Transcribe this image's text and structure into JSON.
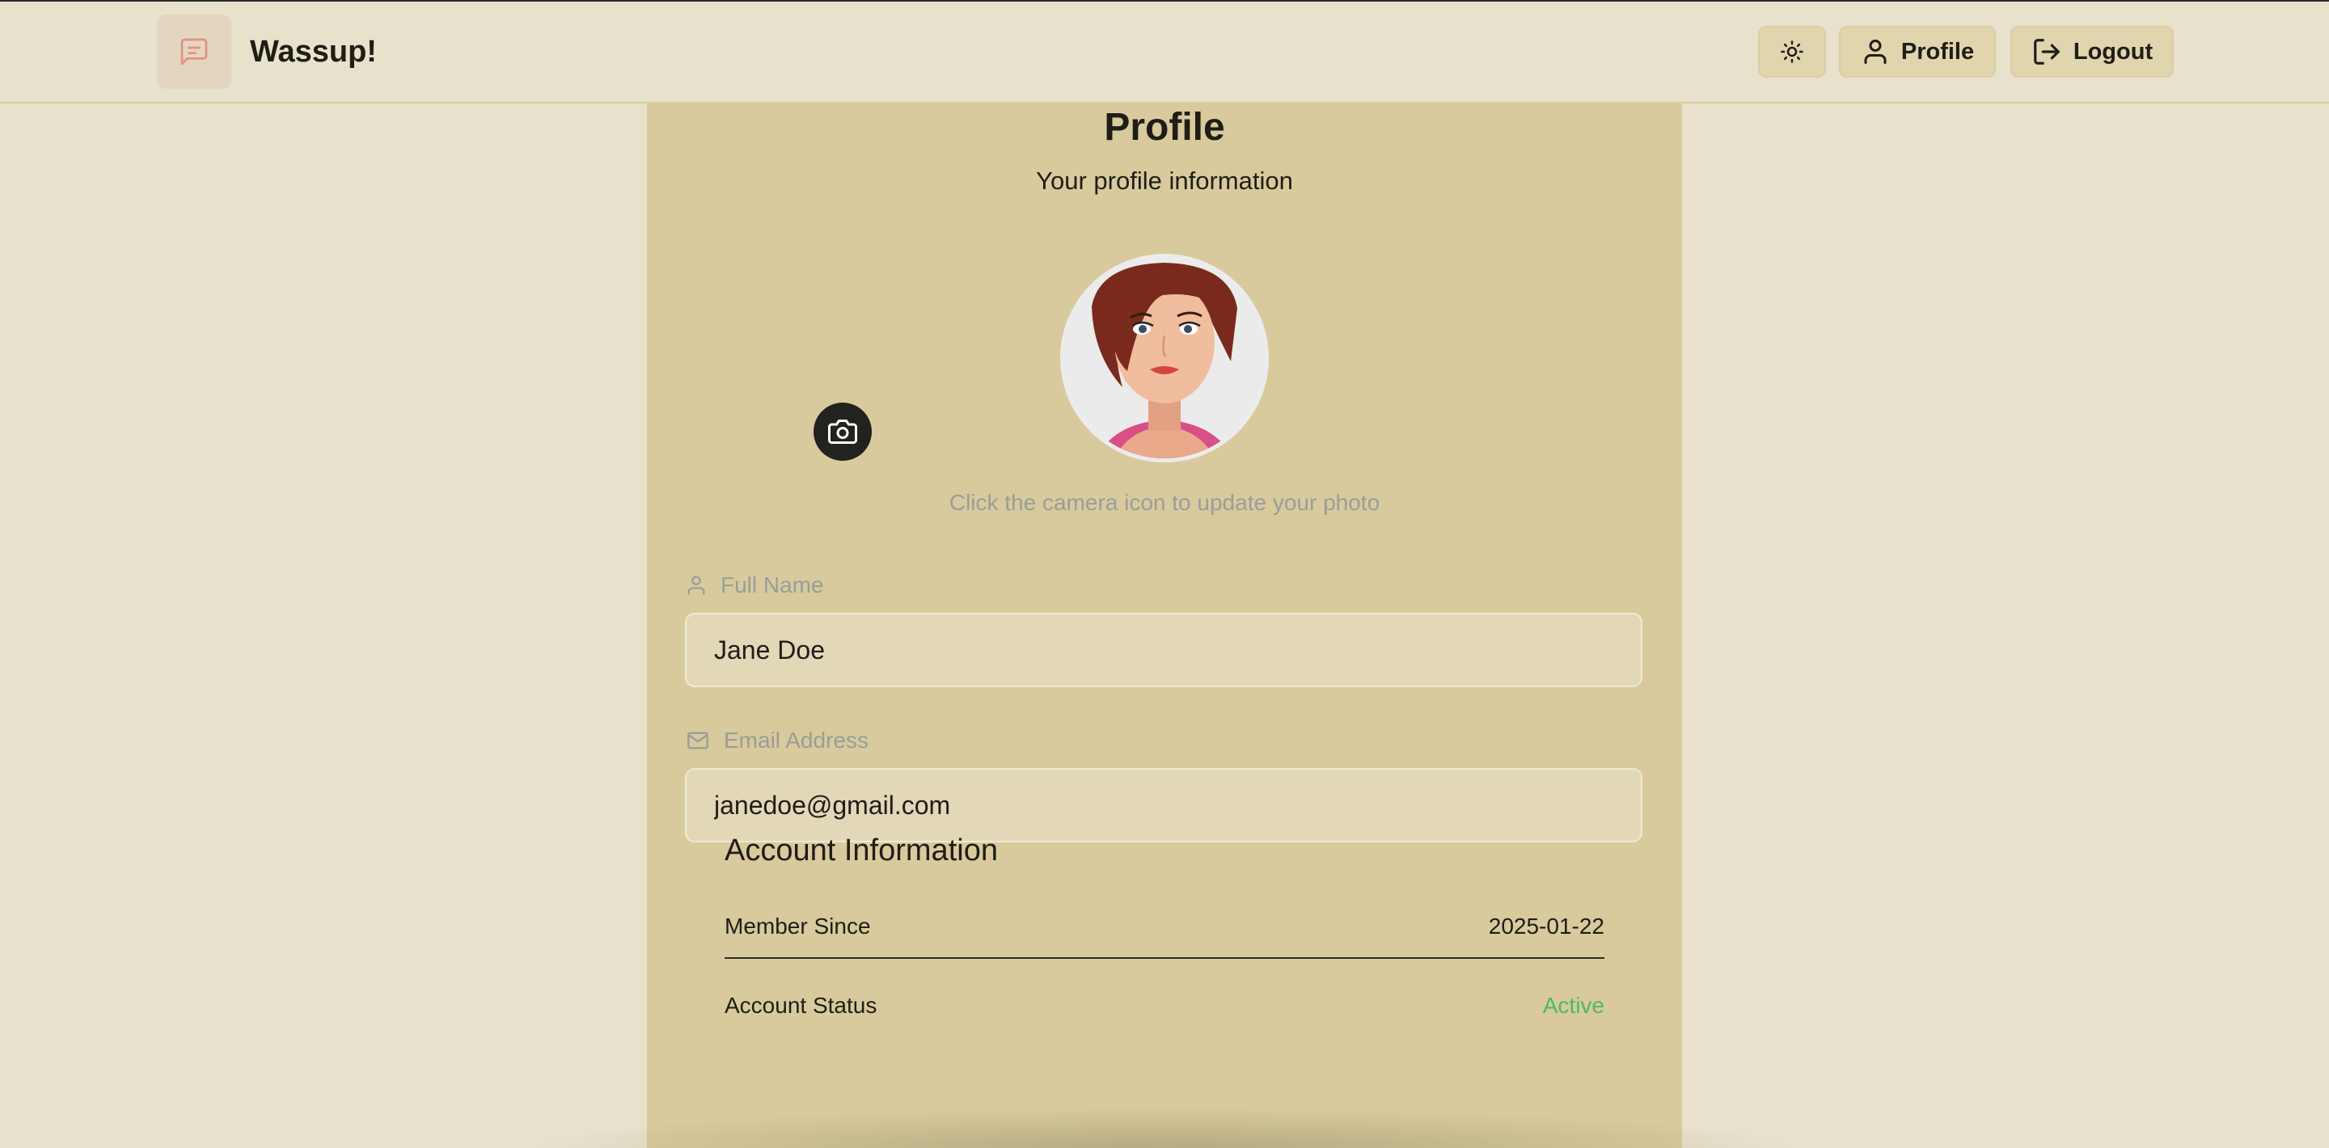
{
  "app": {
    "brand": "Wassup!"
  },
  "nav": {
    "profile_label": "Profile",
    "logout_label": "Logout"
  },
  "profile": {
    "title": "Profile",
    "subtitle": "Your profile information",
    "photo_hint": "Click the camera icon to update your photo",
    "full_name_label": "Full Name",
    "full_name_value": "Jane Doe",
    "email_label": "Email Address",
    "email_value": "janedoe@gmail.com"
  },
  "account": {
    "title": "Account Information",
    "member_since_label": "Member Since",
    "member_since_value": "2025-01-22",
    "status_label": "Account Status",
    "status_value": "Active"
  },
  "colors": {
    "background": "#e8e1cb",
    "card": "#d8ca9c",
    "accent_logo": "#e58f82",
    "status_active": "#4eb86a"
  },
  "icons": [
    "message-square-icon",
    "sun-icon",
    "user-icon",
    "logout-icon",
    "camera-icon",
    "mail-icon"
  ]
}
